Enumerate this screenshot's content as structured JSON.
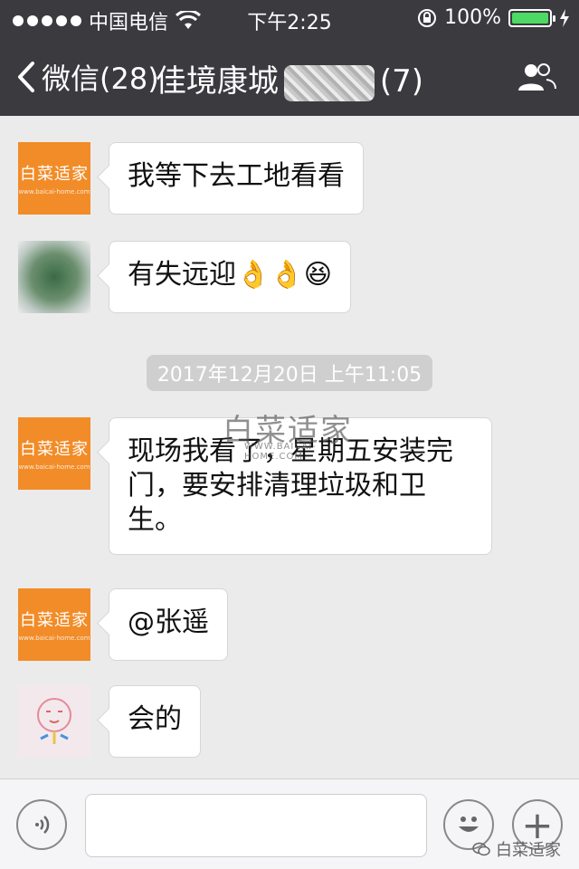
{
  "status": {
    "carrier": "中国电信",
    "time": "下午2:25",
    "battery": "100%"
  },
  "nav": {
    "back_label": "微信(28)",
    "title_left": "佳境康城",
    "title_right": "(7)"
  },
  "messages": [
    {
      "text": "我等下去工地看看",
      "avatar": "brand"
    },
    {
      "text": "有失远迎👌👌😆",
      "avatar": "blurred"
    },
    {
      "text": "现场我看了，星期五安装完门，要安排清理垃圾和卫生。",
      "avatar": "brand"
    },
    {
      "text": "@张遥",
      "avatar": "brand"
    },
    {
      "text": "会的",
      "avatar": "cute"
    }
  ],
  "timestamp": "2017年12月20日 上午11:05",
  "brand": {
    "avatar_text": "白菜适家",
    "avatar_sub": "www.baicai-home.com",
    "watermark": "白菜适家",
    "watermark_sub": "WWW.BAICAI-HOME.COM",
    "footer": "白菜适家"
  }
}
